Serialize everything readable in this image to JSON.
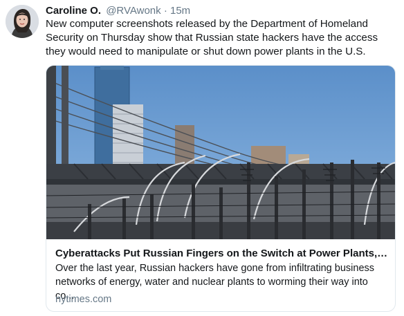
{
  "tweet": {
    "author_name": "Caroline O.",
    "author_handle": "@RVAwonk",
    "separator": "·",
    "timestamp": "15m",
    "text": "New computer screenshots released by the Department of Homeland Security on Thursday show that Russian state hackers have the access they would need to manipulate or shut down power plants in the U.S.",
    "avatar_icon": "profile-photo",
    "card": {
      "title": "Cyberattacks Put Russian Fingers on the Switch at Power Plants, U....",
      "description": "Over the last year, Russian hackers have gone from infiltrating business networks of energy, water and nuclear plants to worming their way into co...",
      "domain": "nytimes.com",
      "image_subject": "power-substation-and-bridge-photo"
    }
  },
  "colors": {
    "text_primary": "#14171a",
    "text_secondary": "#657786",
    "card_border": "#e1e8ed",
    "sky": "#6d9fd4"
  }
}
